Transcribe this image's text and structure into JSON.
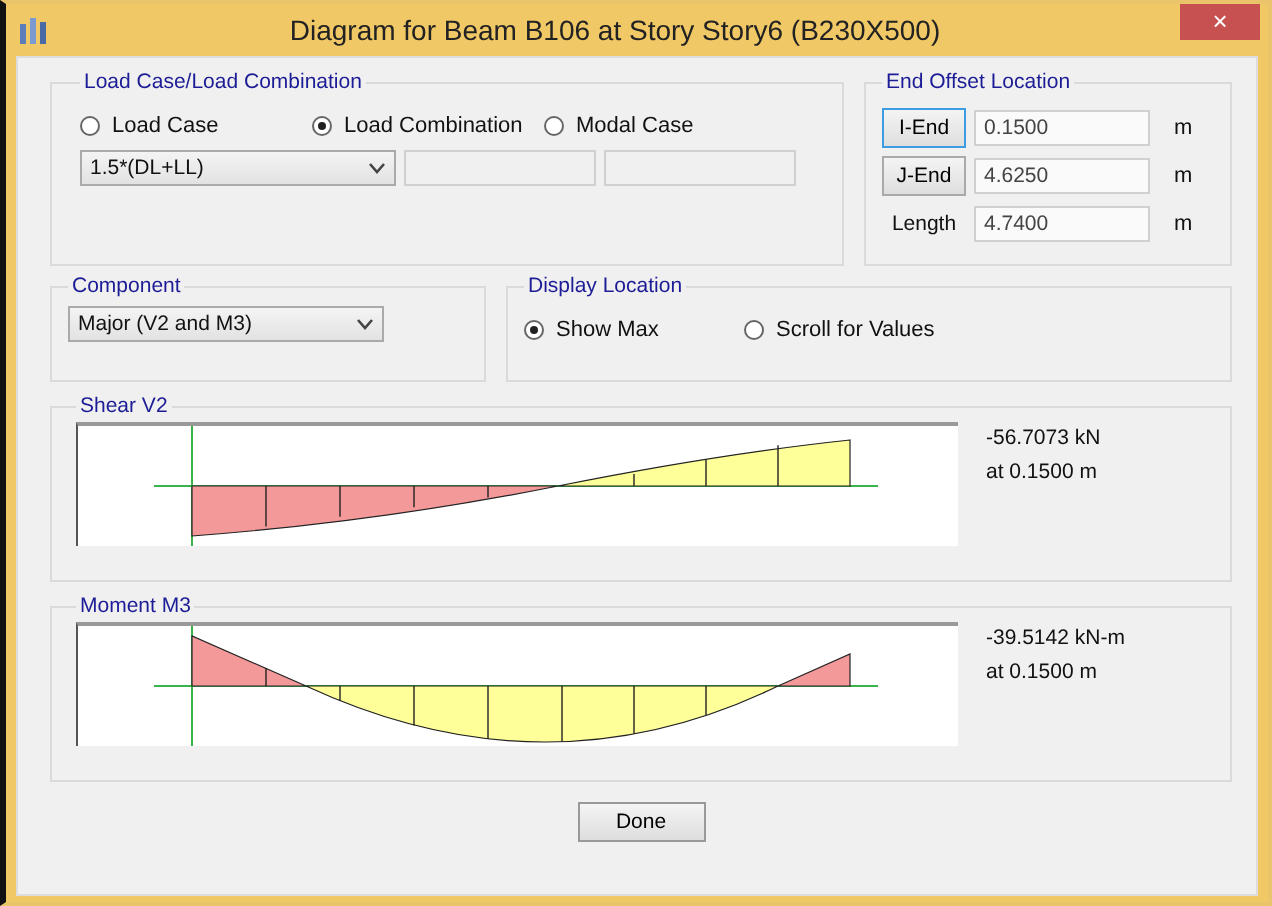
{
  "window": {
    "title": "Diagram for Beam B106 at Story Story6 (B230X500)",
    "close": "×"
  },
  "load_group": {
    "title": "Load Case/Load Combination",
    "options": [
      {
        "label": "Load Case",
        "selected": false
      },
      {
        "label": "Load Combination",
        "selected": true
      },
      {
        "label": "Modal Case",
        "selected": false
      }
    ],
    "combo": "1.5*(DL+LL)"
  },
  "end_offset": {
    "title": "End Offset Location",
    "rows": [
      {
        "kind": "button",
        "label": "I-End",
        "focused": true,
        "value": "0.1500",
        "unit": "m"
      },
      {
        "kind": "button",
        "label": "J-End",
        "focused": false,
        "value": "4.6250",
        "unit": "m"
      },
      {
        "kind": "label",
        "label": "Length",
        "value": "4.7400",
        "unit": "m"
      }
    ]
  },
  "component": {
    "title": "Component",
    "value": "Major (V2 and M3)"
  },
  "display_location": {
    "title": "Display Location",
    "options": [
      {
        "label": "Show Max",
        "selected": true
      },
      {
        "label": "Scroll for Values",
        "selected": false
      }
    ]
  },
  "diagrams": [
    {
      "kind": "shear",
      "title": "Shear V2",
      "reading": "-56.7073 kN",
      "location": "at 0.1500 m"
    },
    {
      "kind": "moment",
      "title": "Moment M3",
      "reading": "-39.5142 kN-m",
      "location": "at 0.1500 m"
    }
  ],
  "buttons": [
    "Done"
  ]
}
